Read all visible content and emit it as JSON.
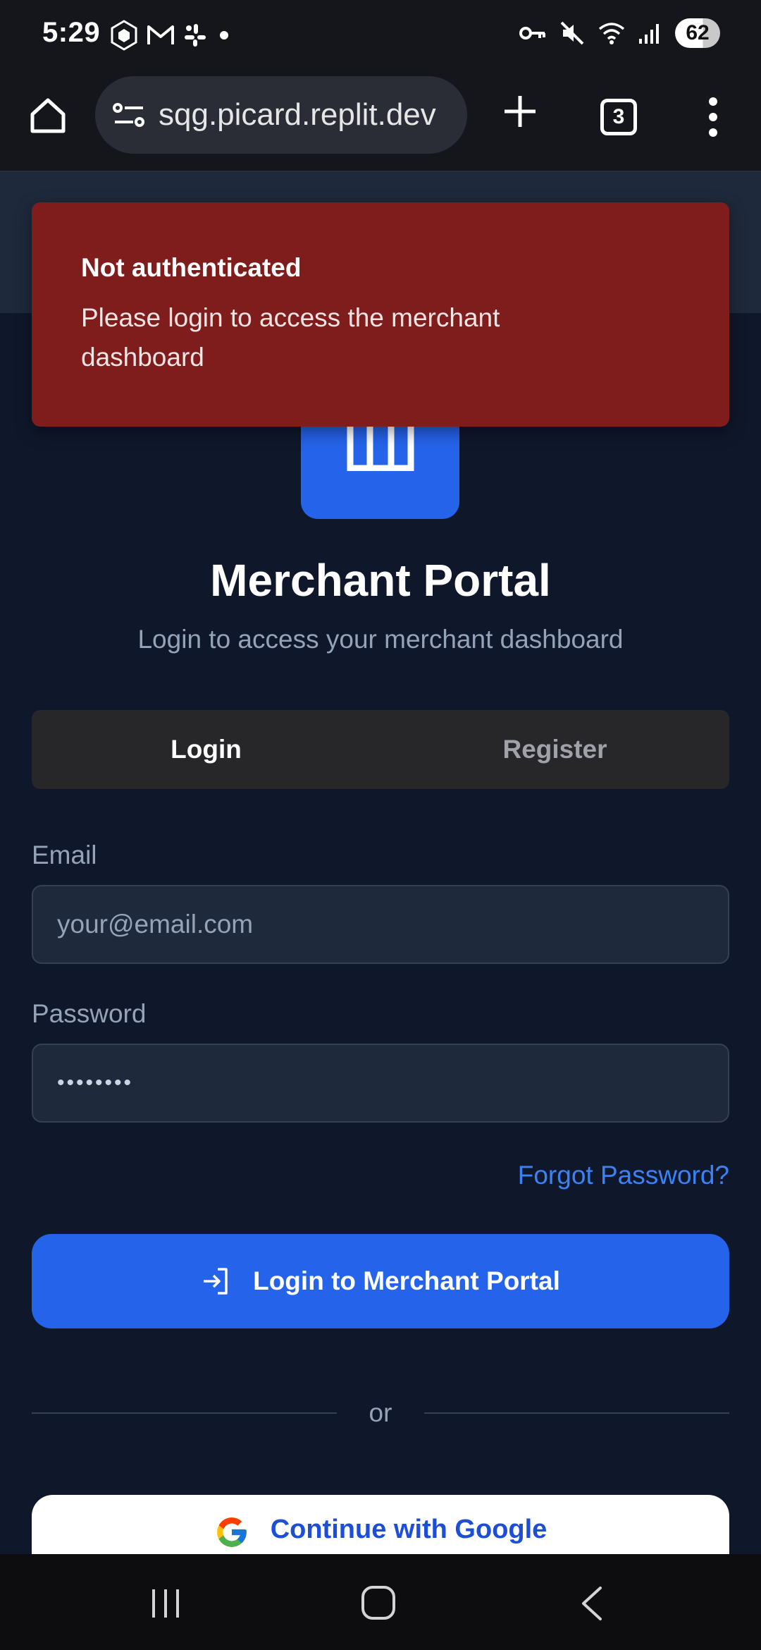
{
  "status_bar": {
    "time": "5:29",
    "battery": "62",
    "left_icons": [
      "crypto-app-icon",
      "gmail-icon",
      "slack-icon",
      "notification-dot-icon"
    ],
    "right_icons": [
      "vpn-key-icon",
      "mute-icon",
      "wifi-icon",
      "signal-icon",
      "battery-icon"
    ]
  },
  "browser": {
    "url": "sqg.picard.replit.dev",
    "tab_count": "3"
  },
  "toast": {
    "title": "Not authenticated",
    "message": "Please login to access the merchant dashboard",
    "color": "#7f1d1d"
  },
  "page": {
    "title": "Merchant Portal",
    "subtitle": "Login to access your merchant dashboard",
    "tabs": [
      {
        "label": "Login",
        "active": true
      },
      {
        "label": "Register",
        "active": false
      }
    ],
    "email": {
      "label": "Email",
      "placeholder": "your@email.com",
      "value": ""
    },
    "password": {
      "label": "Password",
      "value": "••••••••"
    },
    "forgot_password": "Forgot Password?",
    "login_button": "Login to Merchant Portal",
    "divider_text": "or",
    "google_button": "Continue with Google",
    "accent_color": "#2563eb"
  }
}
